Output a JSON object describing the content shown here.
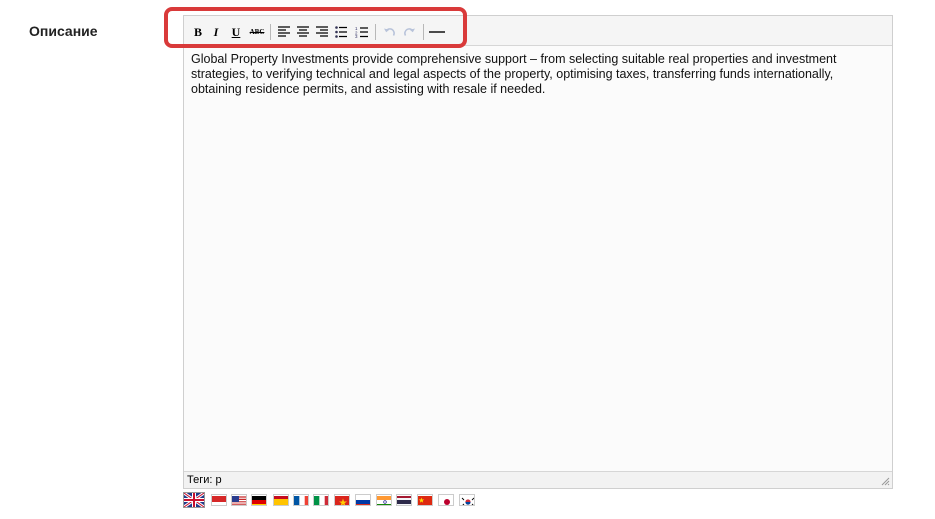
{
  "field": {
    "label": "Описание"
  },
  "toolbar": {
    "bold": "B",
    "italic": "I",
    "underline": "U",
    "strikethrough": "ABC",
    "align_left": "align-left-icon",
    "align_center": "align-center-icon",
    "align_right": "align-right-icon",
    "bullet_list": "bullet-list-icon",
    "numbered_list": "numbered-list-icon",
    "undo": "undo-icon",
    "redo": "redo-icon",
    "hr": "horizontal-rule-icon"
  },
  "editor": {
    "content": "Global Property Investments provide comprehensive support – from selecting suitable real properties and investment strategies, to verifying technical and legal aspects of the property, optimising taxes, transferring funds internationally, obtaining residence permits, and assisting with resale if needed.",
    "status": "Теги: p"
  },
  "languages": [
    {
      "code": "en",
      "selected": true
    },
    {
      "code": "id",
      "selected": false
    },
    {
      "code": "us",
      "selected": false
    },
    {
      "code": "de",
      "selected": false
    },
    {
      "code": "es",
      "selected": false
    },
    {
      "code": "fr",
      "selected": false
    },
    {
      "code": "it",
      "selected": false
    },
    {
      "code": "vn",
      "selected": false
    },
    {
      "code": "ru",
      "selected": false
    },
    {
      "code": "in",
      "selected": false
    },
    {
      "code": "th",
      "selected": false
    },
    {
      "code": "cn",
      "selected": false
    },
    {
      "code": "jp",
      "selected": false
    },
    {
      "code": "kr",
      "selected": false
    }
  ],
  "colors": {
    "highlight": "#d93a3a"
  }
}
